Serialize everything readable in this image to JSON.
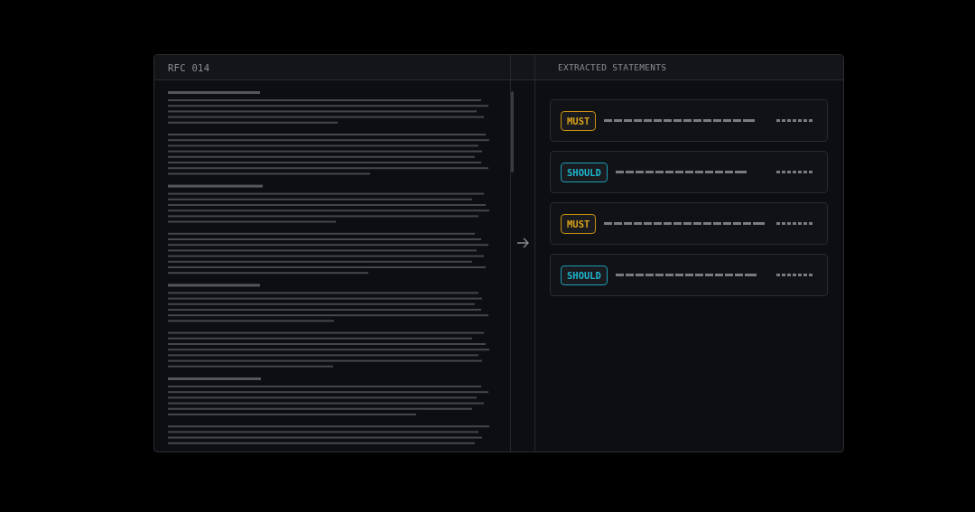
{
  "document": {
    "title": "RFC 014"
  },
  "statements_panel": {
    "title": "EXTRACTED STATEMENTS"
  },
  "statements": [
    {
      "label": "MUST",
      "kind": "must"
    },
    {
      "label": "SHOULD",
      "kind": "should"
    },
    {
      "label": "MUST",
      "kind": "must"
    },
    {
      "label": "SHOULD",
      "kind": "should"
    }
  ]
}
